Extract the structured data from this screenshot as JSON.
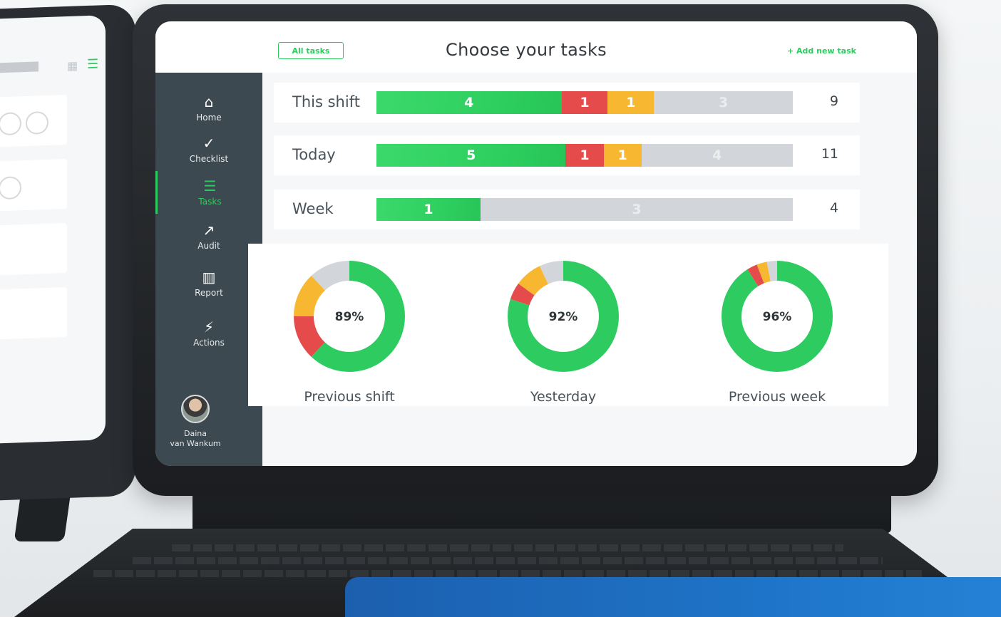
{
  "header": {
    "all_tasks_label": "All tasks",
    "title": "Choose your tasks",
    "add_task_label": "+ Add new task"
  },
  "sidebar": {
    "items": [
      {
        "label": "Home",
        "icon": "home-icon",
        "glyph": "⌂"
      },
      {
        "label": "Checklist",
        "icon": "checklist-icon",
        "glyph": "✓"
      },
      {
        "label": "Tasks",
        "icon": "tasks-icon",
        "glyph": "☰",
        "active": true
      },
      {
        "label": "Audit",
        "icon": "audit-icon",
        "glyph": "↗"
      },
      {
        "label": "Report",
        "icon": "report-icon",
        "glyph": "▥"
      },
      {
        "label": "Actions",
        "icon": "actions-icon",
        "glyph": "⚡"
      }
    ],
    "user": {
      "first": "Daina",
      "last": "van Wankum"
    }
  },
  "rows": [
    {
      "label": "This shift",
      "total": "9",
      "segments": [
        {
          "color": "green",
          "value": "4"
        },
        {
          "color": "red",
          "value": "1"
        },
        {
          "color": "yellow",
          "value": "1"
        },
        {
          "color": "gray",
          "value": "3"
        }
      ]
    },
    {
      "label": "Today",
      "total": "11",
      "segments": [
        {
          "color": "green",
          "value": "5"
        },
        {
          "color": "red",
          "value": "1"
        },
        {
          "color": "yellow",
          "value": "1"
        },
        {
          "color": "gray",
          "value": "4"
        }
      ]
    },
    {
      "label": "Week",
      "total": "4",
      "segments": [
        {
          "color": "green",
          "value": "1"
        },
        {
          "color": "gray",
          "value": "3"
        }
      ]
    }
  ],
  "donuts": [
    {
      "caption": "Previous shift",
      "percent_label": "89%",
      "slices": [
        {
          "color": "green",
          "fraction": 0.62
        },
        {
          "color": "red",
          "fraction": 0.13
        },
        {
          "color": "yellow",
          "fraction": 0.13
        },
        {
          "color": "gray",
          "fraction": 0.12
        }
      ]
    },
    {
      "caption": "Yesterday",
      "percent_label": "92%",
      "slices": [
        {
          "color": "green",
          "fraction": 0.8
        },
        {
          "color": "red",
          "fraction": 0.05
        },
        {
          "color": "yellow",
          "fraction": 0.08
        },
        {
          "color": "gray",
          "fraction": 0.07
        }
      ]
    },
    {
      "caption": "Previous week",
      "percent_label": "96%",
      "slices": [
        {
          "color": "green",
          "fraction": 0.91
        },
        {
          "color": "red",
          "fraction": 0.03
        },
        {
          "color": "yellow",
          "fraction": 0.03
        },
        {
          "color": "gray",
          "fraction": 0.03
        }
      ]
    }
  ],
  "colors": {
    "green": "#2ecc60",
    "red": "#e64b4b",
    "yellow": "#f7b731",
    "gray": "#d2d6da",
    "sidebar": "#3d4950",
    "keyboard_box": "#1e73c7"
  }
}
